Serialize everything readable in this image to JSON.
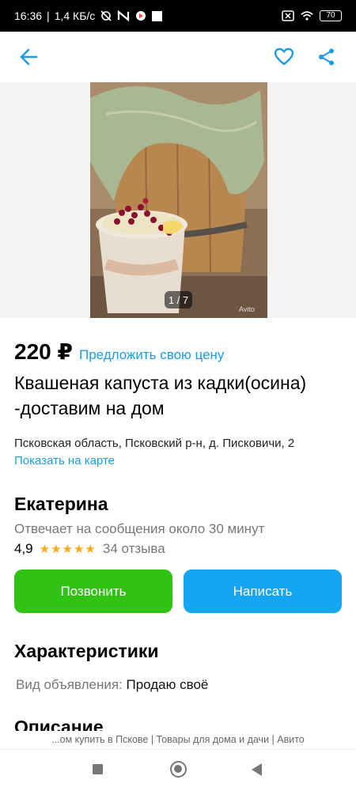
{
  "status_bar": {
    "time": "16:36",
    "speed": "1,4 КБ/с",
    "battery": "70",
    "icons": [
      "muted-alarm-icon",
      "app-n-icon",
      "play-icon",
      "square-icon",
      "sim-x-icon",
      "wifi-icon",
      "battery-icon"
    ]
  },
  "app_bar": {
    "icons": [
      "back-arrow-icon",
      "heart-icon",
      "share-icon"
    ],
    "accent": "#1a9ce4"
  },
  "gallery": {
    "counter": "1 / 7",
    "watermark": "Avito"
  },
  "listing": {
    "price": "220 ₽",
    "offer_link": "Предложить свою цену",
    "title": "Квашеная капуста из кадки(осина) -доставим на дом",
    "address": "Псковская область, Псковский р-н, д. Писковичи, 2",
    "map_link": "Показать на карте"
  },
  "seller": {
    "name": "Екатерина",
    "reply_time": "Отвечает на сообщения около 30 минут",
    "rating": "4,9",
    "stars": "★★★★★",
    "rating_value": 4.9,
    "reviews": "34 отзыва"
  },
  "actions": {
    "call_label": "Позвонить",
    "write_label": "Написать",
    "call_color": "#31c214",
    "write_color": "#14a6f2"
  },
  "characteristics": {
    "title": "Характеристики",
    "label": "Вид объявления:",
    "value": "Продаю своё"
  },
  "description": {
    "title": "Описание"
  },
  "browser": {
    "page_title": "...ом купить в Пскове | Товары для дома и дачи | Авито"
  },
  "nav_bar": {
    "icons": [
      "recents-icon",
      "home-icon",
      "back-icon"
    ]
  }
}
